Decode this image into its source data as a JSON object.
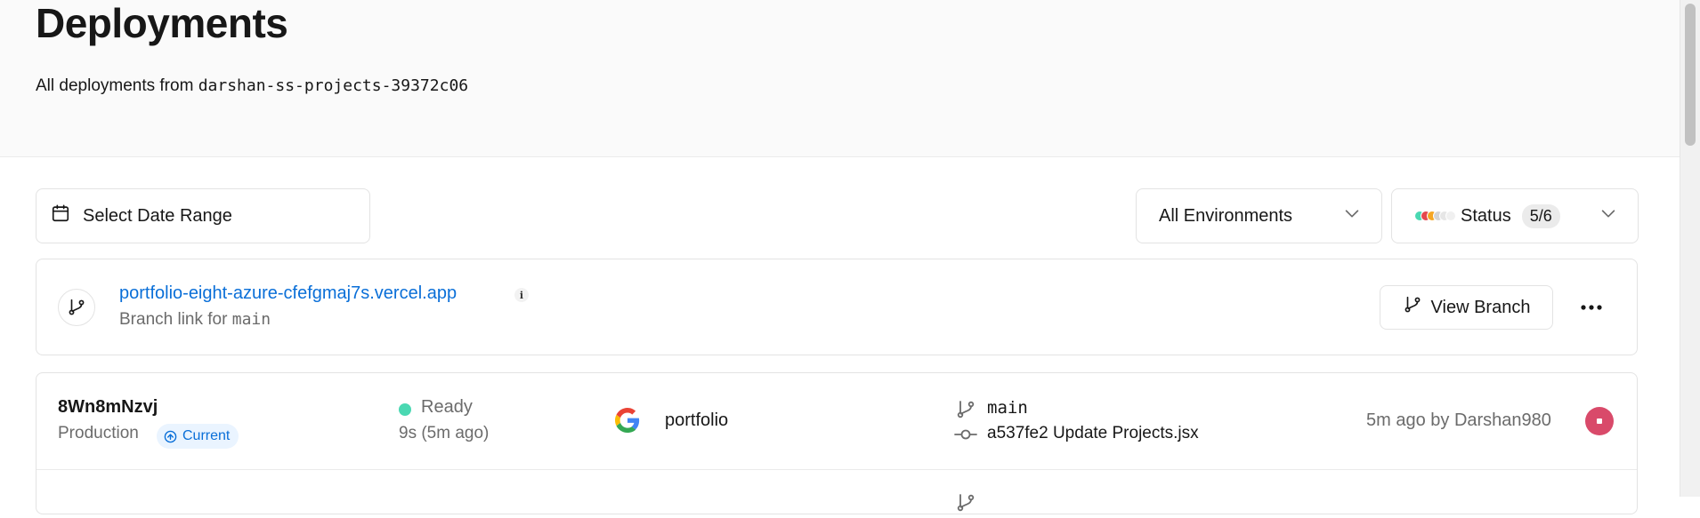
{
  "header": {
    "title": "Deployments",
    "subtitle_prefix": "All deployments from ",
    "team_slug": "darshan-ss-projects-39372c06"
  },
  "filters": {
    "date_range_label": "Select Date Range",
    "environment_label": "All Environments",
    "status_label": "Status",
    "status_count": "5/6",
    "status_dot_colors": [
      "#4ad8b2",
      "#e5484d",
      "#f5a623",
      "#d4d4d4",
      "#e6e6e6",
      "#f0f0f0"
    ]
  },
  "branch_link": {
    "url": "portfolio-eight-azure-cfefgmaj7s.vercel.app",
    "description_prefix": "Branch link for ",
    "branch": "main",
    "view_branch_label": "View Branch"
  },
  "deployments": [
    {
      "id": "8Wn8mNzvj",
      "environment": "Production",
      "badge": "Current",
      "status": "Ready",
      "status_color": "#4ad8b2",
      "duration": "9s (5m ago)",
      "project": "portfolio",
      "project_icon": "google-icon",
      "branch": "main",
      "commit": "a537fe2 Update Projects.jsx",
      "time_author": "5m ago by Darshan980",
      "avatar_color": "#d94a6a"
    }
  ],
  "colors": {
    "link": "#0a6fd8",
    "muted_text": "#6b6b6b",
    "border": "#e3e3e3",
    "header_bg": "#fafafa"
  }
}
